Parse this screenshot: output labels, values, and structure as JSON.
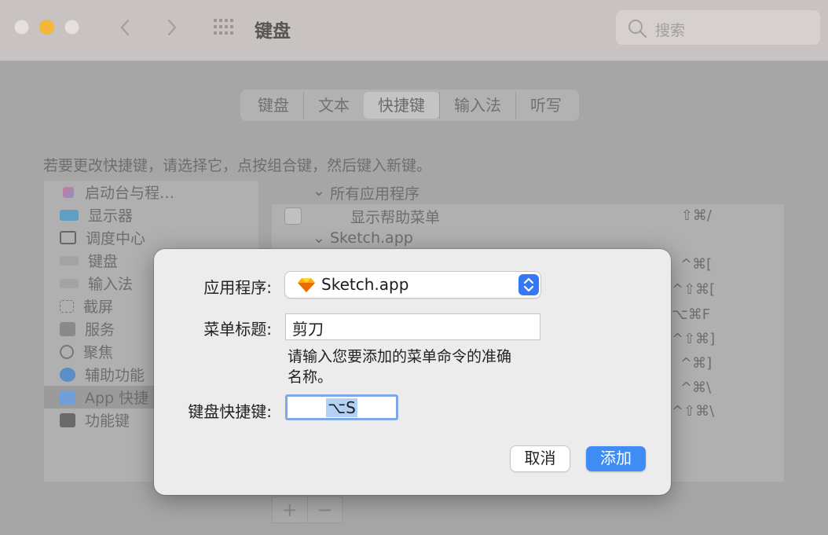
{
  "window": {
    "title": "键盘"
  },
  "search": {
    "placeholder": "搜索"
  },
  "tabs": [
    {
      "label": "键盘"
    },
    {
      "label": "文本"
    },
    {
      "label": "快捷键"
    },
    {
      "label": "输入法"
    },
    {
      "label": "听写"
    }
  ],
  "instruction": "若要更改快捷键，请选择它，点按组合键，然后键入新键。",
  "sidebar": {
    "items": [
      {
        "label": "启动台与程…"
      },
      {
        "label": "显示器"
      },
      {
        "label": "调度中心"
      },
      {
        "label": "键盘"
      },
      {
        "label": "输入法"
      },
      {
        "label": "截屏"
      },
      {
        "label": "服务"
      },
      {
        "label": "聚焦"
      },
      {
        "label": "辅助功能"
      },
      {
        "label": "App 快捷"
      },
      {
        "label": "功能键"
      }
    ]
  },
  "shortcuts": {
    "group_all": "所有应用程序",
    "item_help": "显示帮助菜单",
    "item_help_key": "⇧⌘/",
    "group_sketch": "Sketch.app",
    "visible_keys": [
      "^⌘[",
      "^⇧⌘[",
      "⌥⌘F",
      "^⇧⌘]",
      "^⌘]",
      "^⌘\\",
      "^⇧⌘\\"
    ]
  },
  "bottom_bar": {
    "plus": "+",
    "minus": "−"
  },
  "dialog": {
    "app_label": "应用程序:",
    "app_value": "Sketch.app",
    "menu_title_label": "菜单标题:",
    "menu_title_value": "剪刀",
    "hint": "请输入您要添加的菜单命令的准确名称。",
    "shortcut_label": "键盘快捷键:",
    "shortcut_value": "⌥S",
    "cancel": "取消",
    "add": "添加"
  },
  "colors": {
    "accent": "#3f8cf5",
    "minimize": "#f4b73a"
  }
}
